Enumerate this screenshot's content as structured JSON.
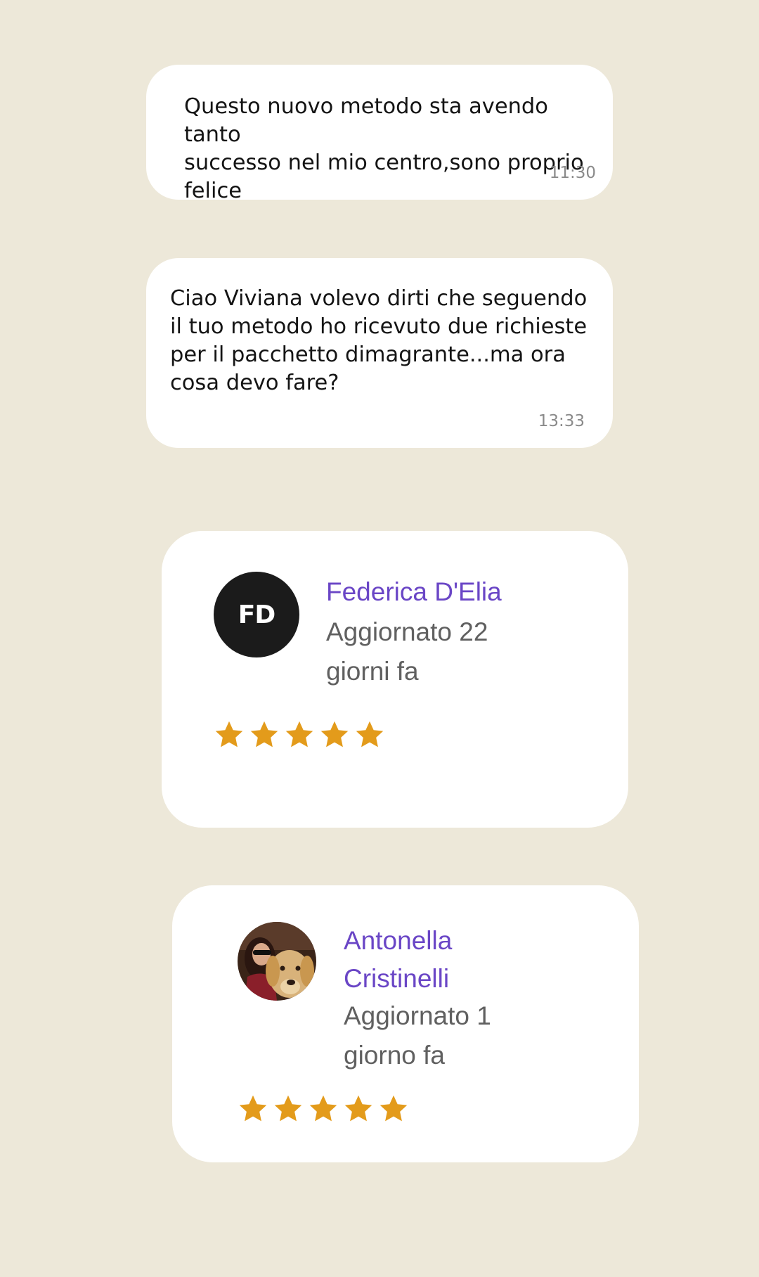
{
  "messages": [
    {
      "text": "Questo nuovo metodo sta avendo tanto\nsuccesso nel mio centro,sono proprio\nfelice",
      "time": "11:30"
    },
    {
      "text": "Ciao Viviana volevo dirti che seguendo\nil tuo metodo ho ricevuto due richieste\nper il pacchetto dimagrante...ma ora\ncosa devo fare?",
      "time": "13:33"
    }
  ],
  "reviews": [
    {
      "avatar_initials": "FD",
      "name": "Federica D'Elia",
      "updated": "Aggiornato 22\ngiorni fa",
      "rating": 5
    },
    {
      "avatar_icon": "user-photo-avatar",
      "name": "Antonella\nCristinelli",
      "updated": "Aggiornato 1\ngiorno fa",
      "rating": 5
    }
  ],
  "colors": {
    "background": "#ede8d9",
    "name": "#6a46c6",
    "star": "#e39b1b"
  }
}
